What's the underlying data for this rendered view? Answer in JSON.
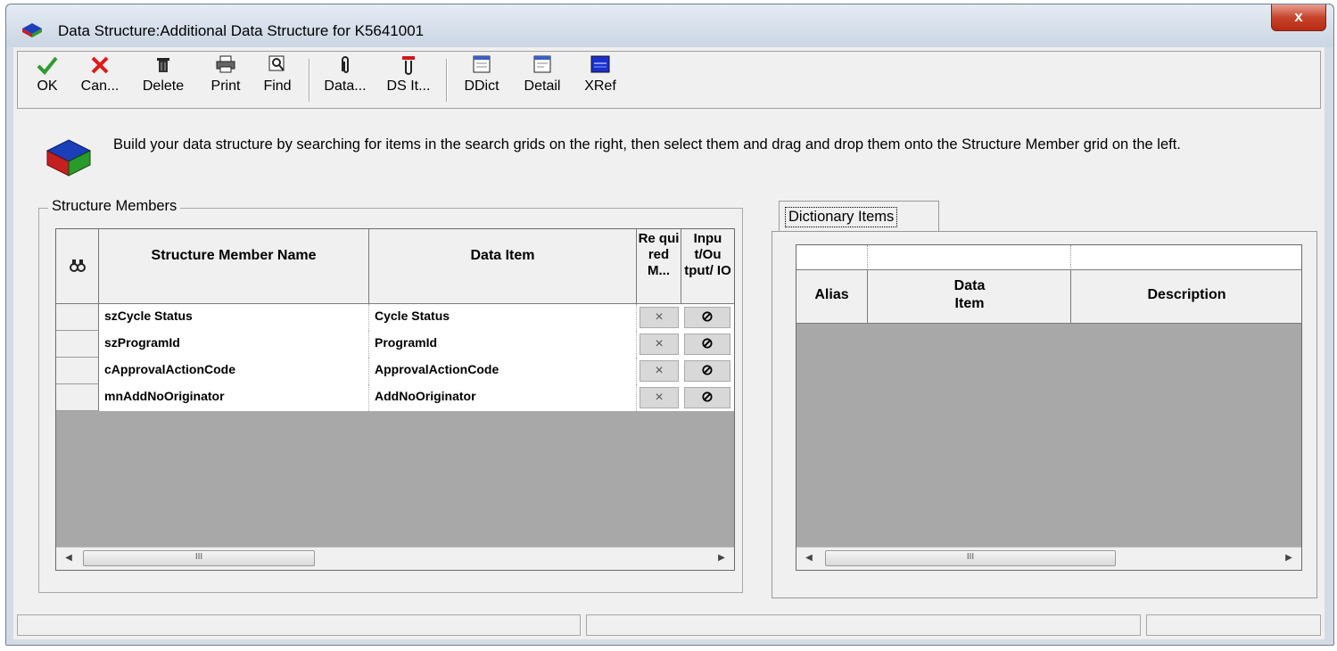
{
  "window": {
    "title": "Data Structure:Additional Data Structure for K5641001",
    "close_label": "x"
  },
  "toolbar": {
    "ok": "OK",
    "cancel": "Can...",
    "delete": "Delete",
    "print": "Print",
    "find": "Find",
    "data": "Data...",
    "ds_items": "DS It...",
    "ddict": "DDict",
    "detail": "Detail",
    "xref": "XRef"
  },
  "instructions": "Build your data structure by searching for items in the search grids on the right, then select them and drag and drop them onto the Structure Member grid on the left.",
  "structure_members": {
    "group_title": "Structure Members",
    "columns": {
      "member_name": "Structure Member Name",
      "data_item": "Data Item",
      "required": "Re qui red M...",
      "io": "Inpu t/Ou tput/ IO"
    },
    "rows": [
      {
        "member_name": "szCycle Status",
        "data_item": "Cycle Status",
        "required": "×",
        "io": "⊘"
      },
      {
        "member_name": "szProgramId",
        "data_item": "ProgramId",
        "required": "×",
        "io": "⊘"
      },
      {
        "member_name": "cApprovalActionCode",
        "data_item": "ApprovalActionCode",
        "required": "×",
        "io": "⊘"
      },
      {
        "member_name": "mnAddNoOriginator",
        "data_item": "AddNoOriginator",
        "required": "×",
        "io": "⊘"
      }
    ],
    "scroll_thumb": "III"
  },
  "dictionary": {
    "tab_label": "Dictionary Items",
    "columns": {
      "alias": "Alias",
      "data_item": "Data Item",
      "description": "Description"
    },
    "scroll_thumb": "III"
  },
  "colors": {
    "ok_green": "#2e9a2e",
    "cancel_red": "#e01818",
    "close_red": "#c7432b"
  }
}
